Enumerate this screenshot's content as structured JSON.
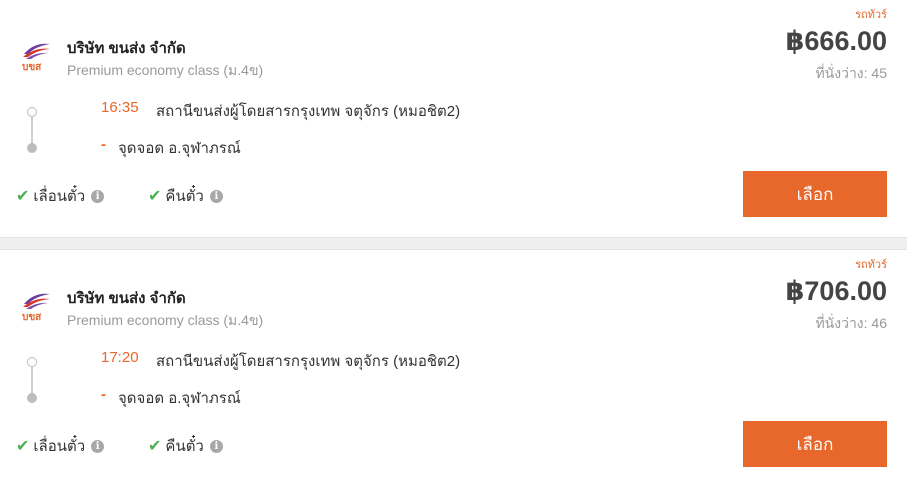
{
  "colors": {
    "accent": "#e8672a",
    "check": "#4caf50",
    "muted": "#9a9a9a"
  },
  "trips": [
    {
      "tag": "รถทัวร์",
      "logo_text": "บขส",
      "operator": "บริษัท ขนส่ง จำกัด",
      "bus_class": "Premium economy class (ม.4ข)",
      "price": "฿666.00",
      "seats": "ที่นั่งว่าง: 45",
      "departure_time": "16:35",
      "departure_station": "สถานีขนส่งผู้โดยสารกรุงเทพ จตุจักร (หมอชิต2)",
      "arrival_dash": "-",
      "arrival_station": "จุดจอด อ.จุฬาภรณ์",
      "policy_reschedule": "เลื่อนตั๋ว",
      "policy_refund": "คืนตั๋ว",
      "select_label": "เลือก"
    },
    {
      "tag": "รถทัวร์",
      "logo_text": "บขส",
      "operator": "บริษัท ขนส่ง จำกัด",
      "bus_class": "Premium economy class (ม.4ข)",
      "price": "฿706.00",
      "seats": "ที่นั่งว่าง: 46",
      "departure_time": "17:20",
      "departure_station": "สถานีขนส่งผู้โดยสารกรุงเทพ จตุจักร (หมอชิต2)",
      "arrival_dash": "-",
      "arrival_station": "จุดจอด อ.จุฬาภรณ์",
      "policy_reschedule": "เลื่อนตั๋ว",
      "policy_refund": "คืนตั๋ว",
      "select_label": "เลือก"
    }
  ]
}
